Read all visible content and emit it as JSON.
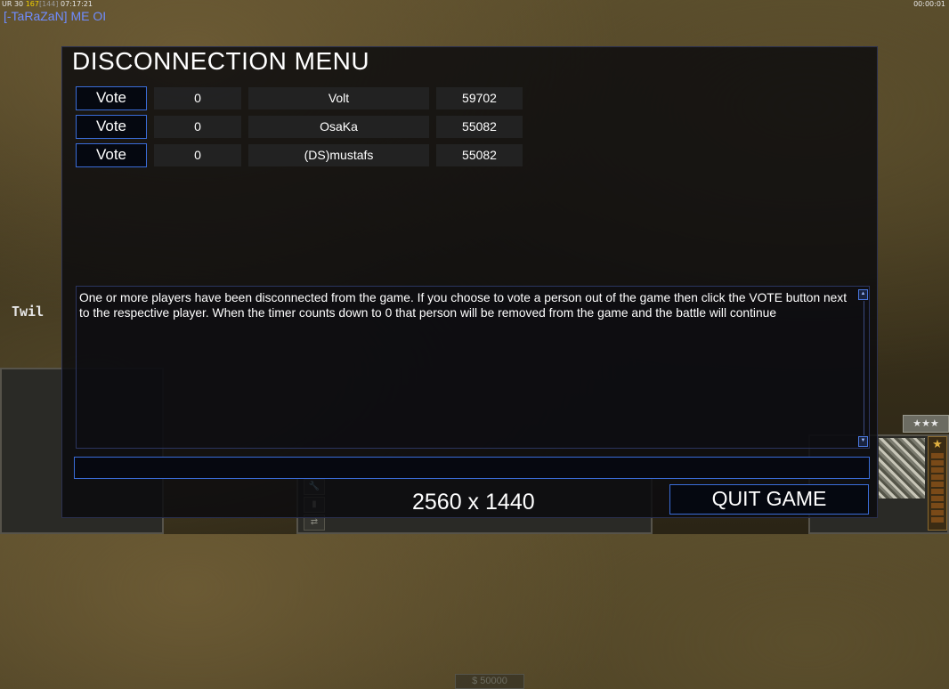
{
  "hud": {
    "stats": {
      "prefix": "UR 30",
      "highlight": "167",
      "sub": "[144]",
      "time": "07:17:21"
    },
    "timer": "00:00:01",
    "chat_line": "[-TaRaZaN] ME OI",
    "side_name": "Twil",
    "rank_stars": "★★★",
    "money": "$ 50000"
  },
  "dialog": {
    "title": "DISCONNECTION MENU",
    "players": [
      {
        "vote_label": "Vote",
        "count": "0",
        "name": "Volt",
        "ping": "59702"
      },
      {
        "vote_label": "Vote",
        "count": "0",
        "name": "OsaKa",
        "ping": "55082"
      },
      {
        "vote_label": "Vote",
        "count": "0",
        "name": "(DS)mustafs",
        "ping": "55082"
      }
    ],
    "message": "One or more players have been disconnected from the game. If you choose to vote a person out of the game then click the VOTE button next to the respective player. When the timer counts down to 0 that person will be removed from the game and the battle will continue",
    "chat_input_value": "",
    "quit_label": "QUIT GAME",
    "resolution": "2560 x 1440"
  },
  "colors": {
    "accent_border": "#3a6cd8",
    "chat_blue": "#6f8cff",
    "hud_yellow": "#f0d000"
  }
}
